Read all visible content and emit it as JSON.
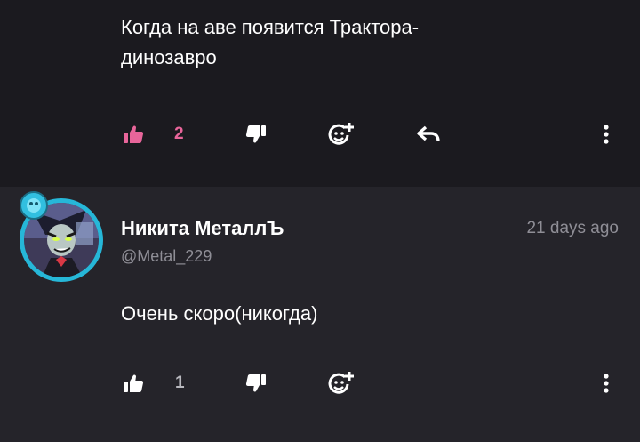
{
  "comments": [
    {
      "text": "Когда на аве появится Трактора-динозавро",
      "text_line1": "Когда на аве появится Трактора-",
      "text_line2": "динозавро",
      "likes": "2",
      "liked": true
    },
    {
      "author": "Никита МеталлЪ",
      "handle": "@Metal_229",
      "time": "21 days ago",
      "text": "Очень скоро(никогда)",
      "likes": "1",
      "liked": false
    }
  ],
  "colors": {
    "bg_top": "#1b1a1f",
    "bg_bottom": "#25242a",
    "like_active": "#e8659a",
    "avatar_ring": "#26b7d8"
  },
  "icons": [
    "thumbs-up-icon",
    "thumbs-down-icon",
    "add-emoji-icon",
    "reply-icon",
    "more-options-icon"
  ]
}
